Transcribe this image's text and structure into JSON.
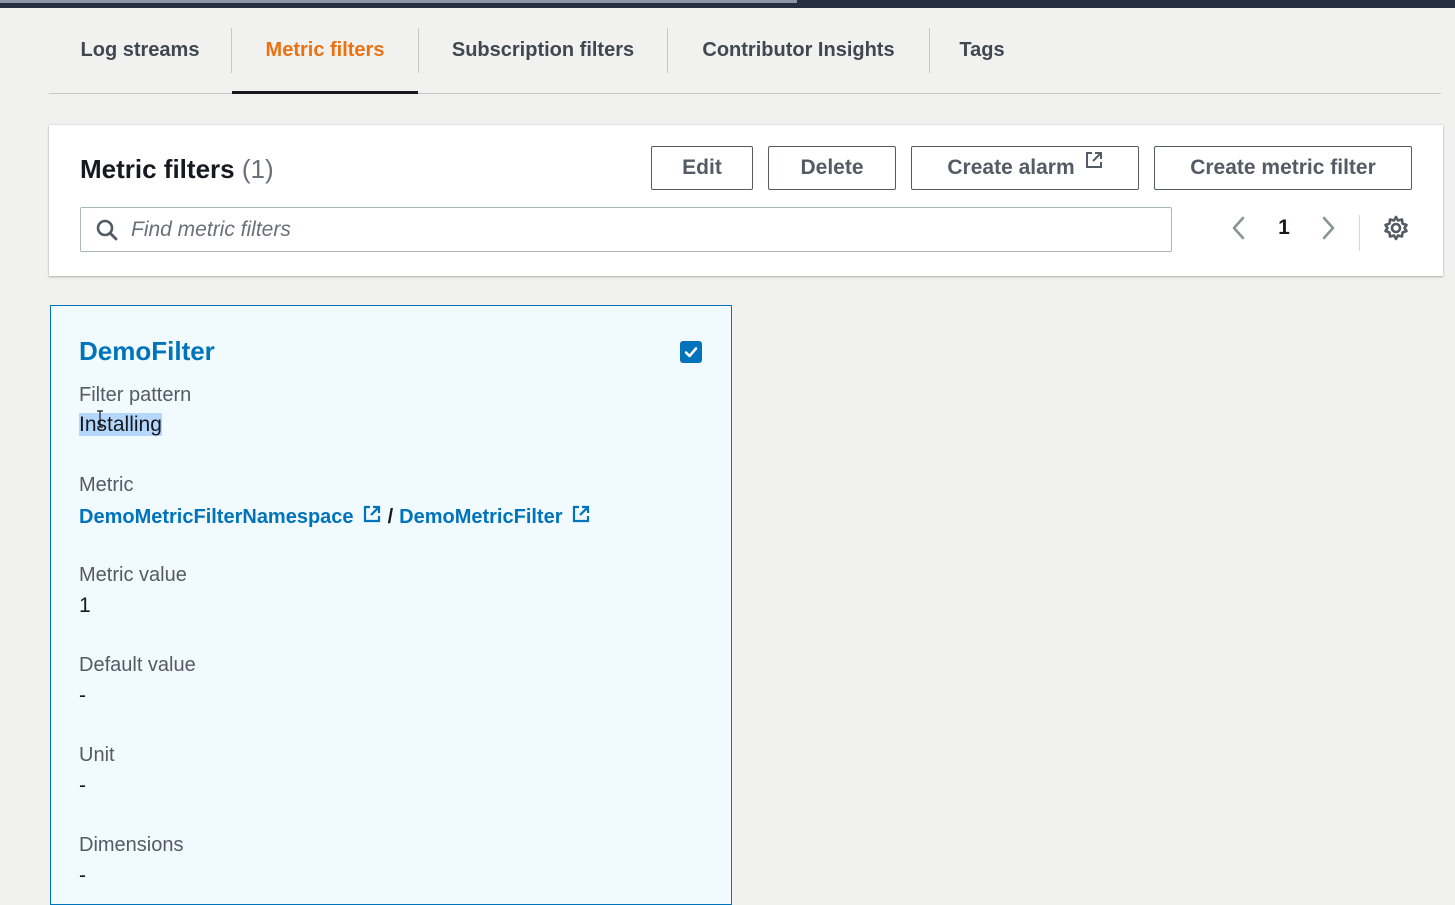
{
  "tabs": [
    {
      "label": "Log streams",
      "active": false
    },
    {
      "label": "Metric filters",
      "active": true
    },
    {
      "label": "Subscription filters",
      "active": false
    },
    {
      "label": "Contributor Insights",
      "active": false
    },
    {
      "label": "Tags",
      "active": false
    }
  ],
  "panel": {
    "title": "Metric filters",
    "count": "(1)",
    "buttons": {
      "edit": "Edit",
      "delete": "Delete",
      "create_alarm": "Create alarm",
      "create_metric_filter": "Create metric filter"
    },
    "search": {
      "placeholder": "Find metric filters",
      "value": ""
    },
    "pagination": {
      "current_page": "1"
    }
  },
  "card": {
    "name": "DemoFilter",
    "selected": true,
    "filter_pattern_label": "Filter pattern",
    "filter_pattern_value": "Installing",
    "metric_label": "Metric",
    "metric_namespace": "DemoMetricFilterNamespace",
    "metric_separator": "/",
    "metric_name": "DemoMetricFilter",
    "metric_value_label": "Metric value",
    "metric_value": "1",
    "default_value_label": "Default value",
    "default_value": "-",
    "unit_label": "Unit",
    "unit_value": "-",
    "dimensions_label": "Dimensions",
    "dimensions_value": "-"
  },
  "colors": {
    "accent_orange": "#ec7211",
    "link_blue": "#0073bb",
    "card_bg": "#f1faff",
    "page_bg": "#f1f1f0"
  }
}
